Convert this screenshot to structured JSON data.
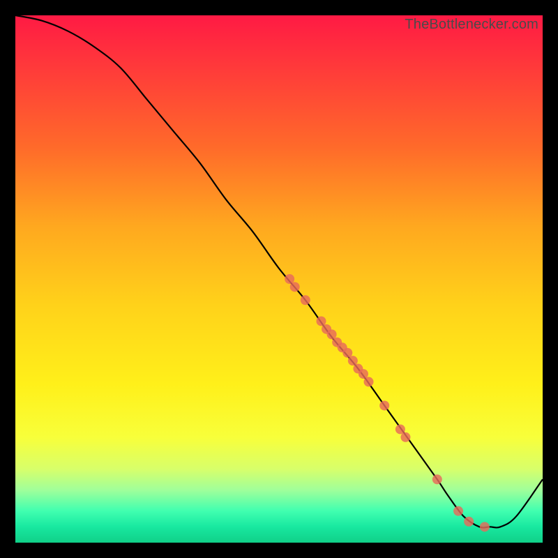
{
  "attribution": "TheBottlenecker.com",
  "chart_data": {
    "type": "line",
    "title": "",
    "xlabel": "",
    "ylabel": "",
    "xlim": [
      0,
      100
    ],
    "ylim": [
      0,
      100
    ],
    "series": [
      {
        "name": "curve",
        "x": [
          0,
          5,
          10,
          15,
          20,
          25,
          30,
          35,
          40,
          45,
          50,
          55,
          60,
          65,
          70,
          75,
          80,
          82,
          85,
          88,
          90,
          92,
          95,
          100
        ],
        "y": [
          100,
          99,
          97,
          94,
          90,
          84,
          78,
          72,
          65,
          59,
          52,
          46,
          39,
          33,
          26,
          19,
          12,
          9,
          5,
          3,
          3,
          3,
          5,
          12
        ]
      }
    ],
    "markers": {
      "name": "dots",
      "x": [
        52,
        53,
        55,
        58,
        59,
        60,
        61,
        62,
        63,
        64,
        65,
        66,
        67,
        70,
        73,
        74,
        80,
        84,
        86,
        89
      ],
      "y": [
        50,
        48.5,
        46,
        42,
        40.5,
        39.5,
        38,
        37,
        36,
        34.5,
        33,
        32,
        30.5,
        26,
        21.5,
        20,
        12,
        6,
        4,
        3
      ],
      "radius": 7
    },
    "background_gradient": {
      "top": "#ff1a44",
      "mid": "#fff01a",
      "bottom": "#10d088"
    }
  }
}
